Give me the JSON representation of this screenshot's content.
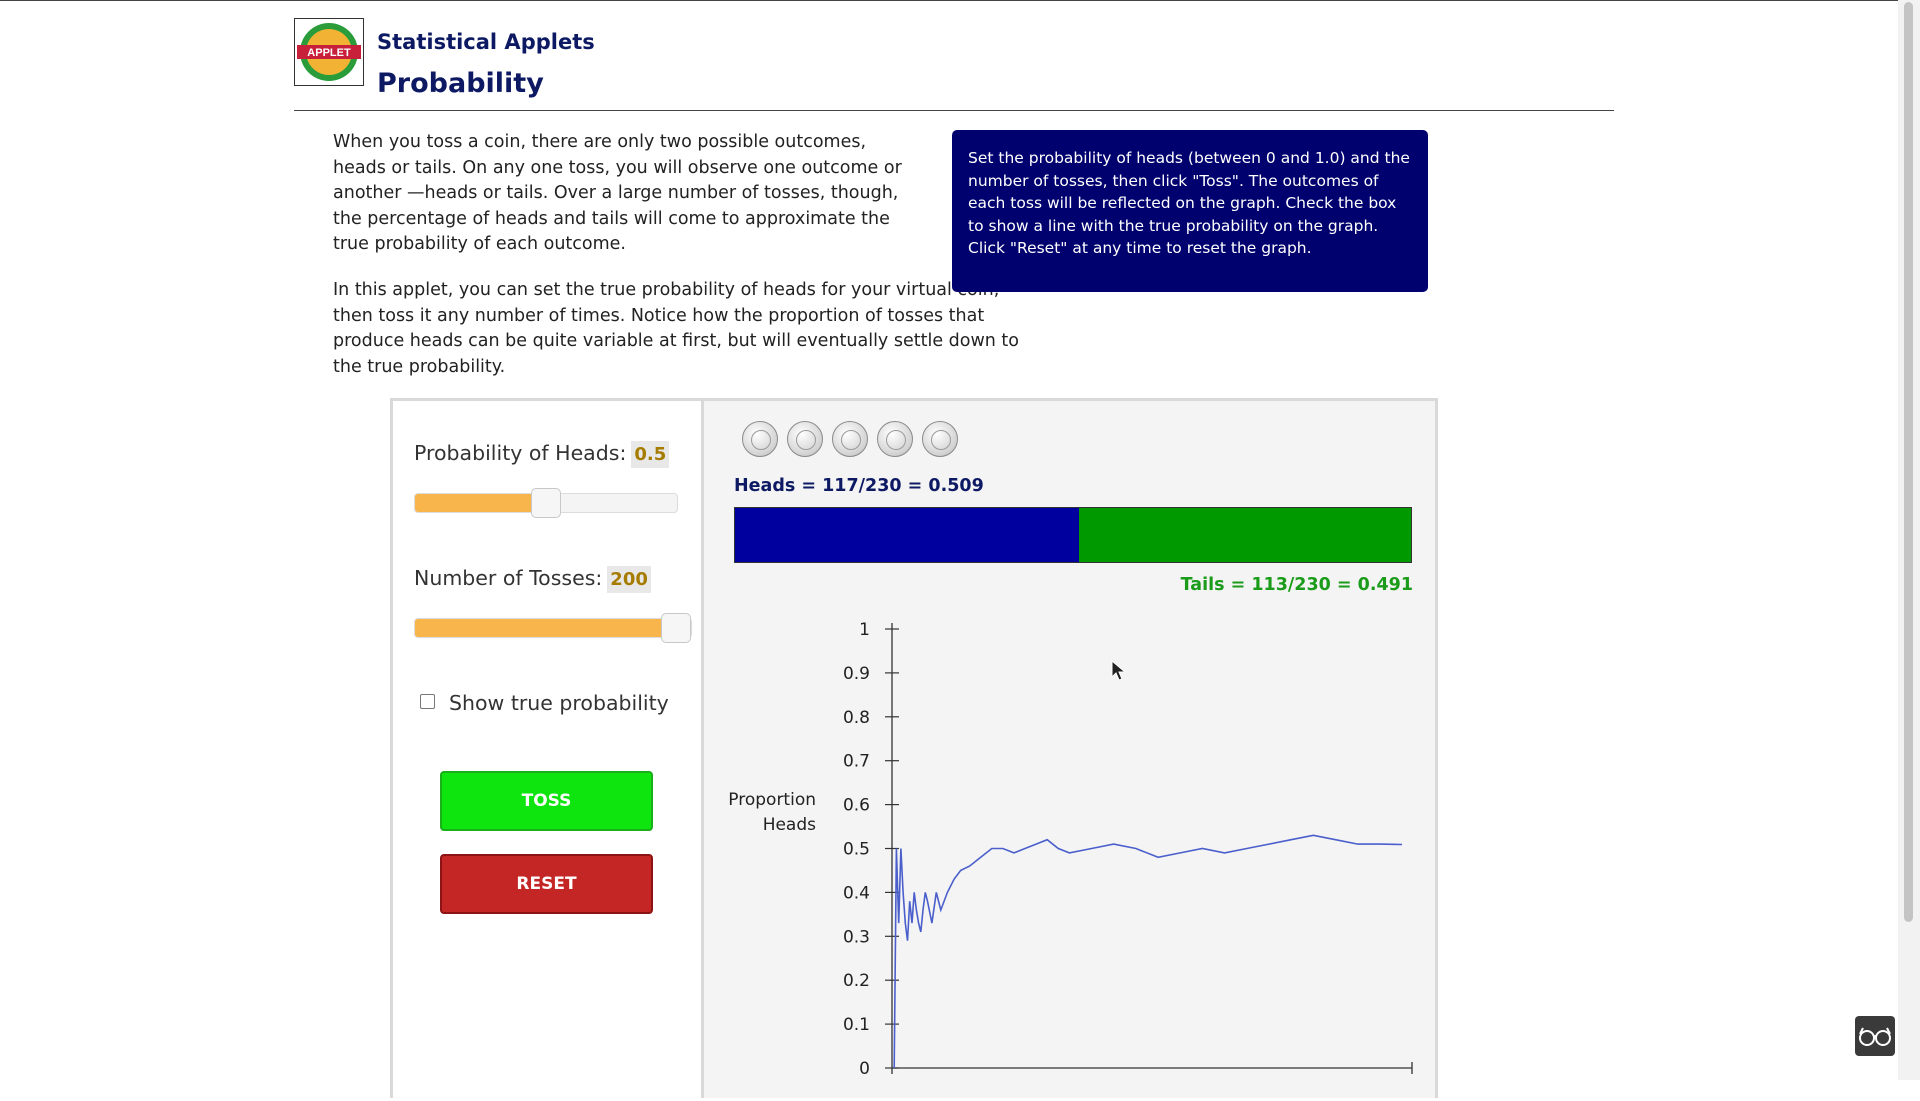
{
  "header": {
    "site_title": "Statistical Applets",
    "page_title": "Probability",
    "logo_text": "APPLET"
  },
  "intro": {
    "paragraph_1": "When you toss a coin, there are only two possible outcomes, heads or tails. On any one toss, you will observe one outcome or another —heads or tails. Over a large number of tosses, though, the percentage of heads and tails will come to approximate the true probability of each outcome.",
    "paragraph_2": "In this applet, you can set the true probability of heads for your virtual coin, then toss it any number of times. Notice how the proportion of tosses that produce heads can be quite variable at first, but will eventually settle down to the true probability."
  },
  "instructions": "Set the probability of heads (between 0 and 1.0) and the number of tosses, then click \"Toss\". The outcomes of each toss will be reflected on the graph. Check the box to show a line with the true probability on the graph. Click \"Reset\" at any time to reset the graph.",
  "controls": {
    "prob_label": "Probability of Heads:",
    "prob_value": "0.5",
    "prob_fraction": 0.5,
    "toss_label": "Number of Tosses:",
    "toss_value": "200",
    "toss_fraction": 1.0,
    "show_true_label": "Show true probability",
    "show_true_checked": false,
    "toss_button": "TOSS",
    "reset_button": "RESET"
  },
  "coins": [
    "coin-heads-icon",
    "coin-heads-icon",
    "coin-tails-icon",
    "coin-heads-icon",
    "coin-heads-icon"
  ],
  "results": {
    "heads_label": "Heads = 117/230 = 0.509",
    "tails_label": "Tails = 113/230 = 0.491",
    "heads_proportion": 0.509,
    "heads_color": "#00009f",
    "tails_color": "#009900"
  },
  "chart_data": {
    "type": "line",
    "ylabel": "Proportion Heads",
    "xlabel": "",
    "ylim": [
      0,
      1
    ],
    "xlim": [
      0,
      230
    ],
    "y_ticks": [
      "0",
      "0.1",
      "0.2",
      "0.3",
      "0.4",
      "0.5",
      "0.6",
      "0.7",
      "0.8",
      "0.9",
      "1"
    ],
    "grid": false,
    "series": [
      {
        "color": "#4a5fcc",
        "x": [
          1,
          2,
          3,
          4,
          5,
          6,
          7,
          8,
          9,
          10,
          11,
          12,
          13,
          14,
          15,
          16,
          18,
          20,
          22,
          25,
          28,
          31,
          35,
          40,
          45,
          50,
          55,
          60,
          65,
          70,
          75,
          80,
          90,
          100,
          110,
          120,
          130,
          140,
          150,
          160,
          170,
          180,
          190,
          200,
          210,
          220,
          230
        ],
        "y": [
          0,
          0.5,
          0.33,
          0.5,
          0.4,
          0.33,
          0.29,
          0.38,
          0.33,
          0.4,
          0.36,
          0.33,
          0.31,
          0.36,
          0.4,
          0.38,
          0.33,
          0.4,
          0.36,
          0.4,
          0.43,
          0.45,
          0.46,
          0.48,
          0.5,
          0.5,
          0.49,
          0.5,
          0.51,
          0.52,
          0.5,
          0.49,
          0.5,
          0.51,
          0.5,
          0.48,
          0.49,
          0.5,
          0.49,
          0.5,
          0.51,
          0.52,
          0.53,
          0.52,
          0.51,
          0.51,
          0.509
        ]
      }
    ]
  }
}
